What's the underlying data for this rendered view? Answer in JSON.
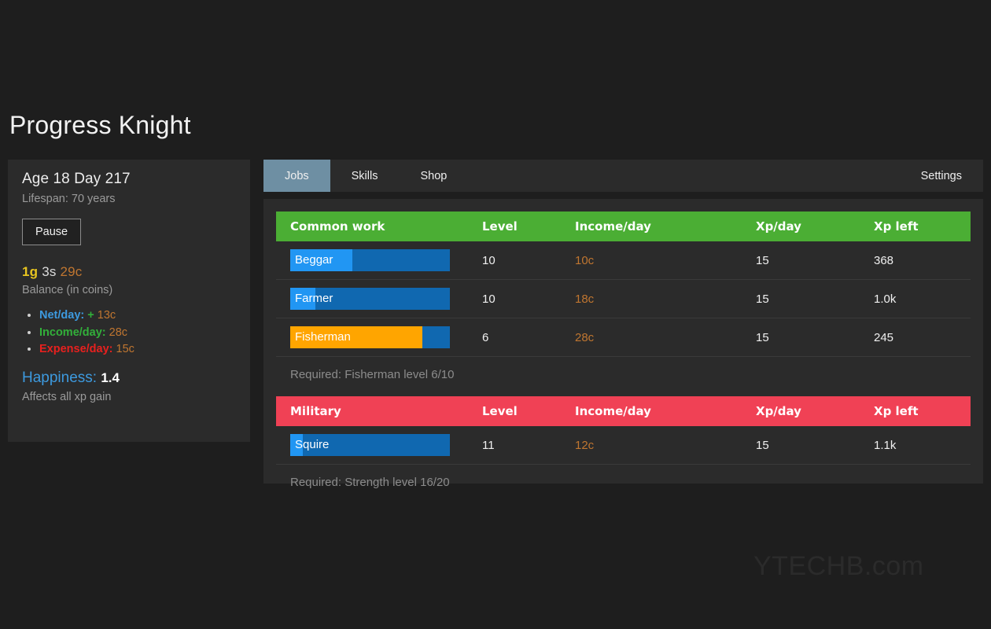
{
  "app": {
    "title": "Progress Knight",
    "watermark": "YTECHB.com"
  },
  "sidebar": {
    "age_line": "Age 18 Day 217",
    "lifespan_line": "Lifespan: 70 years",
    "pause_button": "Pause",
    "balance": {
      "gold": "1g",
      "silver": "3s",
      "copper": "29c",
      "caption": "Balance (in coins)"
    },
    "stats": [
      {
        "label": "Net/day:",
        "sign": "+",
        "value": "13c",
        "color": "#3d9adf"
      },
      {
        "label": "Income/day:",
        "sign": "",
        "value": "28c",
        "color": "#32b03a"
      },
      {
        "label": "Expense/day:",
        "sign": "",
        "value": "15c",
        "color": "#e8201e"
      }
    ],
    "happiness": {
      "label": "Happiness:",
      "value": "1.4",
      "caption": "Affects all xp gain"
    }
  },
  "tabs": {
    "items": [
      {
        "label": "Jobs",
        "active": true
      },
      {
        "label": "Skills",
        "active": false
      },
      {
        "label": "Shop",
        "active": false
      }
    ],
    "settings_label": "Settings"
  },
  "jobs": {
    "columns": [
      "Level",
      "Income/day",
      "Xp/day",
      "Xp left"
    ],
    "categories": [
      {
        "name": "Common work",
        "color": "#4bae34",
        "rows": [
          {
            "name": "Beggar",
            "progress": 39,
            "active": false,
            "level": "10",
            "income": "10c",
            "xp_day": "15",
            "xp_left": "368"
          },
          {
            "name": "Farmer",
            "progress": 16,
            "active": false,
            "level": "10",
            "income": "18c",
            "xp_day": "15",
            "xp_left": "1.0k"
          },
          {
            "name": "Fisherman",
            "progress": 83,
            "active": true,
            "level": "6",
            "income": "28c",
            "xp_day": "15",
            "xp_left": "245"
          }
        ],
        "requirement": "Required: Fisherman level 6/10"
      },
      {
        "name": "Military",
        "color": "#f04155",
        "rows": [
          {
            "name": "Squire",
            "progress": 8,
            "active": false,
            "level": "11",
            "income": "12c",
            "xp_day": "15",
            "xp_left": "1.1k"
          }
        ],
        "requirement": "Required: Strength level 16/20"
      }
    ]
  }
}
